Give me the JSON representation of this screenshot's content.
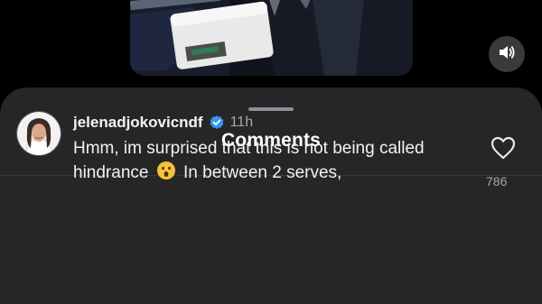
{
  "video": {
    "media_icon": "video-thumbnail",
    "mute_icon": "speaker-icon"
  },
  "comments_sheet": {
    "title": "Comments",
    "comments": [
      {
        "username": "jelenadjokovicndf",
        "verified": true,
        "timestamp": "11h",
        "text_before_emoji": "Hmm, im surprised that this is not being called hindrance",
        "emoji_icon": "astonished-face-emoji",
        "text_after_emoji": "In between 2 serves,",
        "like_count": "786"
      }
    ]
  },
  "colors": {
    "background": "#000000",
    "sheet": "#262628",
    "verified_blue": "#3897f0",
    "muted_text": "#a8a8ad"
  }
}
